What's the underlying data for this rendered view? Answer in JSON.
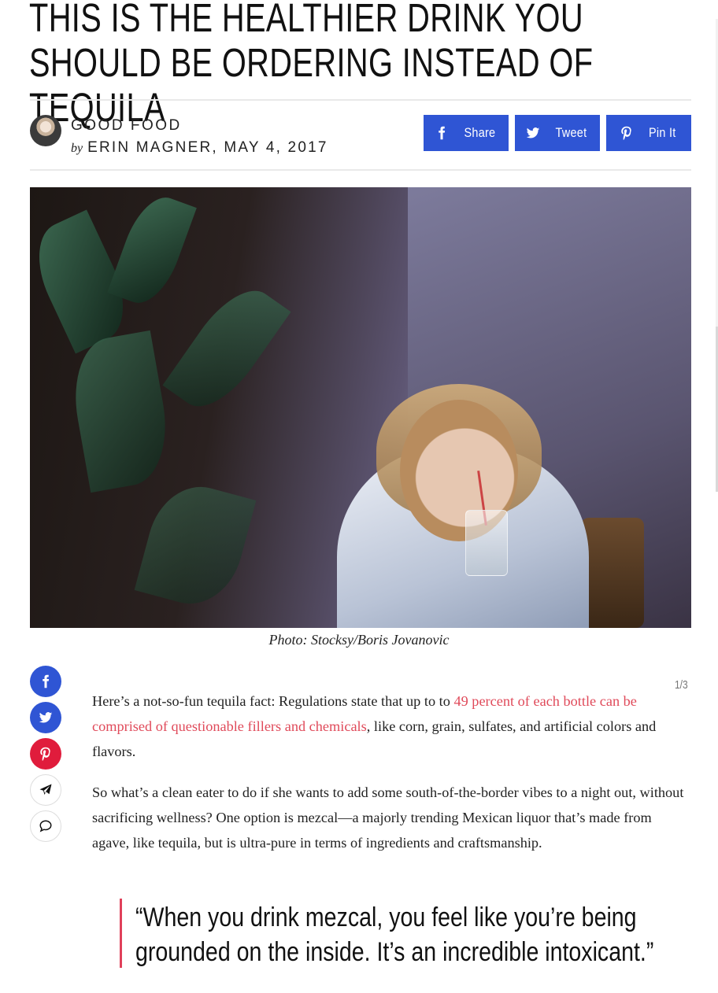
{
  "article": {
    "headline": "THIS IS THE HEALTHIER DRINK YOU SHOULD BE ORDERING INSTEAD OF TEQUILA",
    "category": "GOOD FOOD",
    "by": "by",
    "author_date": "ERIN MAGNER, MAY 4, 2017",
    "caption": "Photo: Stocksy/Boris Jovanovic",
    "counter": "1/3",
    "p1_before": "Here’s a not-so-fun tequila fact: Regulations state that up to to ",
    "p1_link": "49 percent of each bottle can be comprised of questionable fillers and chemicals",
    "p1_after": ", like corn, grain, sulfates, and artificial colors and flavors.",
    "p2": "So what’s a clean eater to do if she wants to add some south-of-the-border vibes to a night out, without sacrificing wellness? One option is mezcal—a majorly trending Mexican liquor that’s made from agave, like tequila, but is ultra-pure in terms of ingredients and craftsmanship.",
    "quote": "“When you drink mezcal, you feel like you’re being grounded on the inside. It’s an incredible intoxicant.”"
  },
  "share": {
    "facebook_label": "Share",
    "twitter_label": "Tweet",
    "pinterest_label": "Pin It"
  },
  "colors": {
    "share_blue": "#2f55d4",
    "pinterest_red": "#e01c3c",
    "link_pink": "#e04a5a",
    "quote_bar": "#e0405a"
  }
}
